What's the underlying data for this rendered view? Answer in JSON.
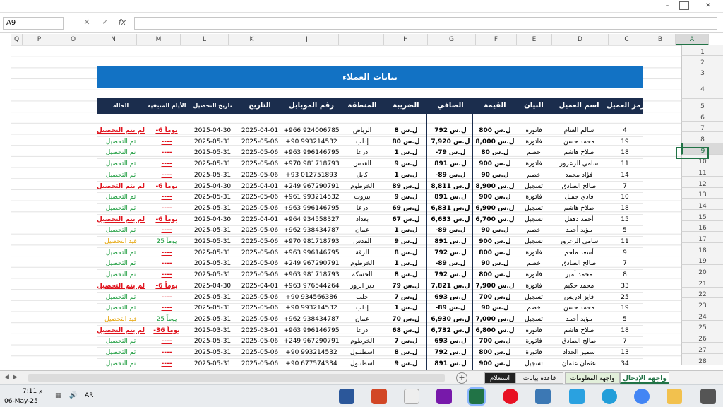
{
  "window": {
    "min": "–",
    "max": "▢",
    "close": "✕"
  },
  "formula_bar": {
    "name_box": "A9",
    "fx": "fx",
    "cancel": "✕",
    "enter": "✓",
    "value": ""
  },
  "columns": [
    "Q",
    "P",
    "O",
    "N",
    "M",
    "L",
    "K",
    "J",
    "I",
    "H",
    "G",
    "F",
    "E",
    "D",
    "C",
    "B",
    "A"
  ],
  "selected_column": "A",
  "rows": [
    "1",
    "2",
    "3",
    "4",
    "5",
    "6",
    "7",
    "8",
    "9",
    "10",
    "11",
    "12",
    "13",
    "14",
    "15",
    "16",
    "17",
    "18",
    "19",
    "20",
    "21",
    "22",
    "23",
    "24",
    "25",
    "26",
    "27",
    "28"
  ],
  "selected_row": "9",
  "sheet_title": "بيانات العملاء",
  "headers": [
    "الحالة",
    "الأيام المتبقية",
    "تاريخ التحصيل",
    "التاريخ",
    "رقم الموبايل",
    "المنطقة",
    "الضريبة",
    "الصافي",
    "القيمة",
    "البيان",
    "اسم العميل",
    "رمز العميل"
  ],
  "records": [
    [
      "لم يتم التحصيل",
      "-6 يوماً",
      "2025-04-30",
      "2025-04-01",
      "+966 924006785",
      "الرياض",
      "8 ل.س",
      "792 ل.س",
      "800 ل.س",
      "فاتورة",
      "سالم الغنام",
      "4"
    ],
    [
      "تم التحصيل",
      "----",
      "2025-05-31",
      "2025-05-06",
      "+90 993214532",
      "إدلب",
      "80 ل.س",
      "7,920 ل.س",
      "8,000 ل.س",
      "فاتورة",
      "محمد حسن",
      "19"
    ],
    [
      "تم التحصيل",
      "----",
      "2025-05-31",
      "2025-05-06",
      "+963 996146795",
      "درعا",
      "1 ل.س",
      "-79 ل.س",
      "80 ل.س",
      "خصم",
      "صلاح هاشم",
      "18"
    ],
    [
      "تم التحصيل",
      "----",
      "2025-05-31",
      "2025-05-06",
      "+970 981718793",
      "القدس",
      "9 ل.س",
      "891 ل.س",
      "900 ل.س",
      "فاتورة",
      "سامي الزعرور",
      "11"
    ],
    [
      "تم التحصيل",
      "----",
      "2025-05-31",
      "2025-05-06",
      "+93 012751893",
      "كابل",
      "1 ل.س",
      "-89 ل.س",
      "90 ل.س",
      "خصم",
      "فؤاد محمد",
      "14"
    ],
    [
      "لم يتم التحصيل",
      "-6 يوماً",
      "2025-04-30",
      "2025-04-01",
      "+249 967290791",
      "الخرطوم",
      "89 ل.س",
      "8,811 ل.س",
      "8,900 ل.س",
      "تسجيل",
      "صالح الصادق",
      "7"
    ],
    [
      "تم التحصيل",
      "----",
      "2025-05-31",
      "2025-05-06",
      "+961 993214532",
      "بيروت",
      "9 ل.س",
      "891 ل.س",
      "900 ل.س",
      "فاتورة",
      "فادي جميل",
      "10"
    ],
    [
      "تم التحصيل",
      "----",
      "2025-05-31",
      "2025-05-06",
      "+963 996146795",
      "درعا",
      "69 ل.س",
      "6,831 ل.س",
      "6,900 ل.س",
      "تسجيل",
      "صلاح هاشم",
      "18"
    ],
    [
      "لم يتم التحصيل",
      "-6 يوماً",
      "2025-04-30",
      "2025-04-01",
      "+964 934558327",
      "بغداد",
      "67 ل.س",
      "6,633 ل.س",
      "6,700 ل.س",
      "تسجيل",
      "أحمد دهقل",
      "15"
    ],
    [
      "تم التحصيل",
      "----",
      "2025-05-31",
      "2025-05-06",
      "+962 938434787",
      "عمان",
      "1 ل.س",
      "-89 ل.س",
      "90 ل.س",
      "خصم",
      "مؤيد أحمد",
      "5"
    ],
    [
      "قيد التحصيل",
      "25 يوماً",
      "2025-05-31",
      "2025-05-06",
      "+970 981718793",
      "القدس",
      "9 ل.س",
      "891 ل.س",
      "900 ل.س",
      "تسجيل",
      "سامي الزعرور",
      "11"
    ],
    [
      "تم التحصيل",
      "----",
      "2025-05-31",
      "2025-05-06",
      "+963 996146795",
      "الرقة",
      "8 ل.س",
      "792 ل.س",
      "800 ل.س",
      "فاتورة",
      "أسعد ملحم",
      "9"
    ],
    [
      "تم التحصيل",
      "----",
      "2025-05-31",
      "2025-05-06",
      "+249 967290791",
      "الخرطوم",
      "1 ل.س",
      "-89 ل.س",
      "90 ل.س",
      "خصم",
      "صالح الصادق",
      "7"
    ],
    [
      "تم التحصيل",
      "----",
      "2025-05-31",
      "2025-05-06",
      "+963 981718793",
      "الحسكة",
      "8 ل.س",
      "792 ل.س",
      "800 ل.س",
      "فاتورة",
      "محمد أمير",
      "8"
    ],
    [
      "لم يتم التحصيل",
      "-6 يوماً",
      "2025-04-30",
      "2025-04-01",
      "+963 976544264",
      "دير الزور",
      "79 ل.س",
      "7,821 ل.س",
      "7,900 ل.س",
      "فاتورة",
      "محمد حكيم",
      "33"
    ],
    [
      "تم التحصيل",
      "----",
      "2025-05-31",
      "2025-05-06",
      "+90 934566386",
      "حلب",
      "7 ل.س",
      "693 ل.س",
      "700 ل.س",
      "تسجيل",
      "فايز ادريس",
      "25"
    ],
    [
      "تم التحصيل",
      "----",
      "2025-05-31",
      "2025-05-06",
      "+90 993214532",
      "إدلب",
      "1 ل.س",
      "-89 ل.س",
      "90 ل.س",
      "خصم",
      "محمد حسن",
      "19"
    ],
    [
      "قيد التحصيل",
      "25 يوماً",
      "2025-05-31",
      "2025-05-06",
      "+962 938434787",
      "عمان",
      "70 ل.س",
      "6,930 ل.س",
      "7,000 ل.س",
      "تسجيل",
      "مؤيد أحمد",
      "5"
    ],
    [
      "لم يتم التحصيل",
      "-36 يوماً",
      "2025-03-31",
      "2025-03-01",
      "+963 996146795",
      "درعا",
      "68 ل.س",
      "6,732 ل.س",
      "6,800 ل.س",
      "فاتورة",
      "صلاح هاشم",
      "18"
    ],
    [
      "تم التحصيل",
      "----",
      "2025-05-31",
      "2025-05-06",
      "+249 967290791",
      "الخرطوم",
      "7 ل.س",
      "693 ل.س",
      "700 ل.س",
      "فاتورة",
      "صالح الصادق",
      "7"
    ],
    [
      "تم التحصيل",
      "----",
      "2025-05-31",
      "2025-05-06",
      "+90 993214532",
      "اسطنبول",
      "8 ل.س",
      "792 ل.س",
      "800 ل.س",
      "فاتورة",
      "سمير الحداد",
      "13"
    ],
    [
      "تم التحصيل",
      "----",
      "2025-05-31",
      "2025-05-06",
      "+90 677574334",
      "اسطنبول",
      "9 ل.س",
      "891 ل.س",
      "900 ل.س",
      "تسجيل",
      "عثمان عثمان",
      "34"
    ]
  ],
  "status_colors": {
    "تم التحصيل": "#1a9b3c",
    "لم يتم التحصيل": "#e0141e",
    "قيد التحصيل": "#e5a50a"
  },
  "tabs": [
    "واجهة الإدخال",
    "واجهة المعلومات",
    "قاعدة بيانات",
    "استعلام"
  ],
  "active_tab": "واجهة الإدخال",
  "taskbar": {
    "time": "7:11 م",
    "date": "06-May-25",
    "lang": "AR"
  }
}
